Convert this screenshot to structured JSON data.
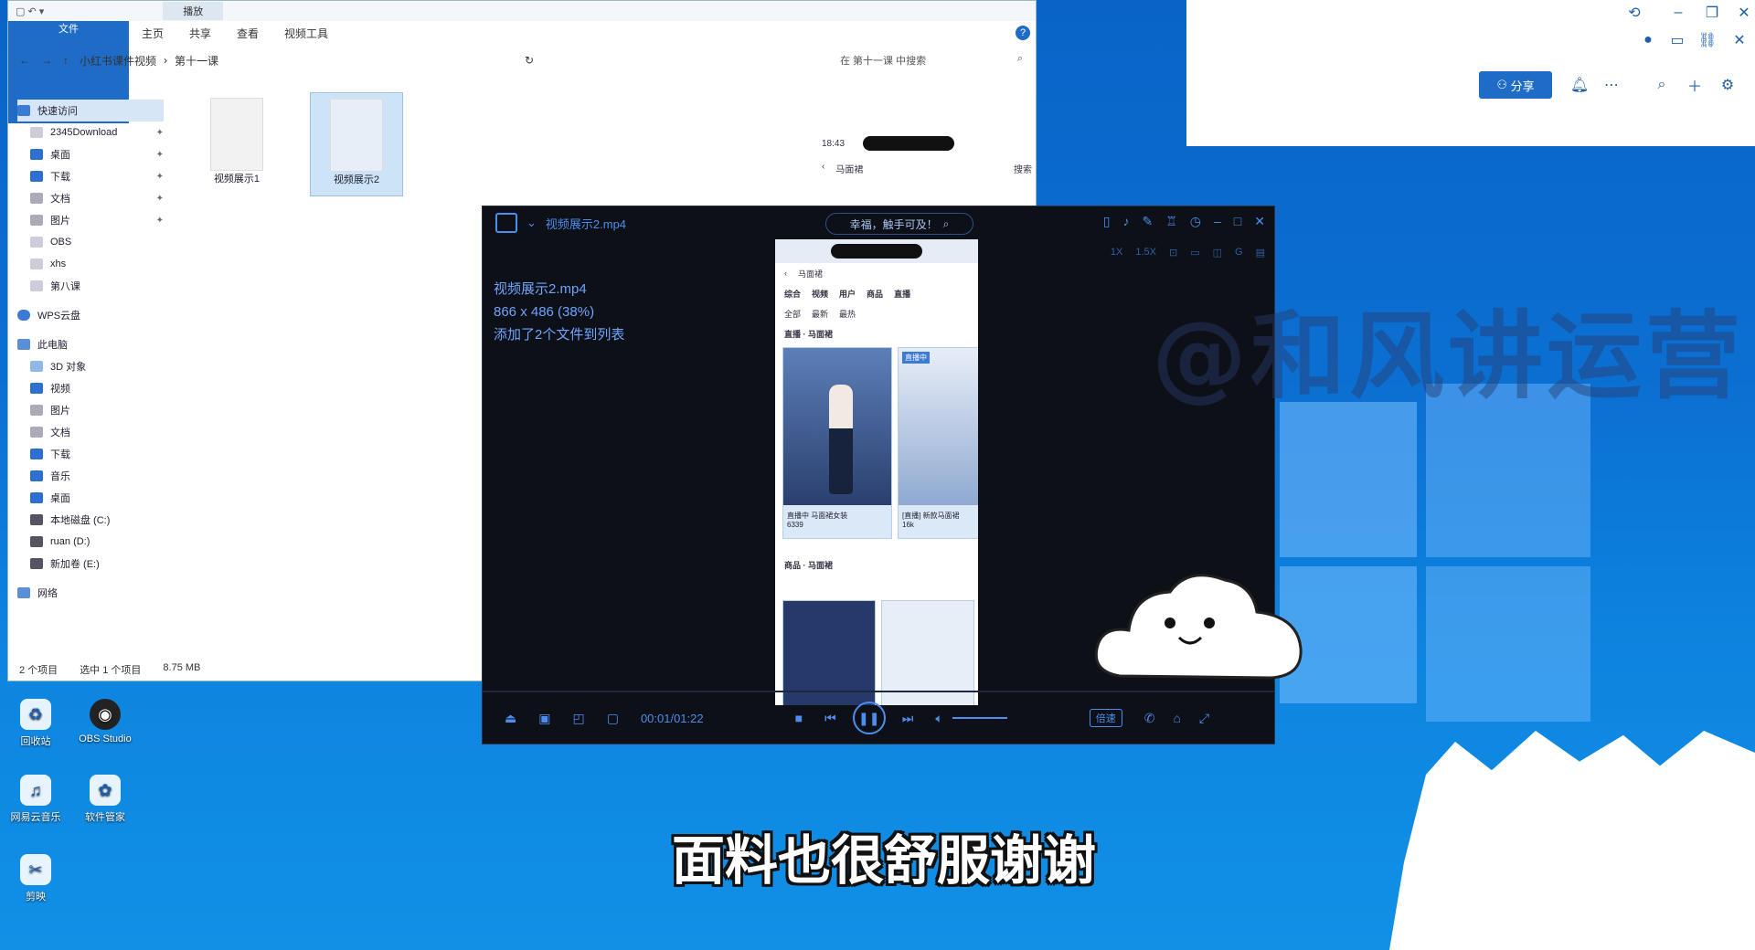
{
  "explorer": {
    "title_context_tab": "播放",
    "ribbon_tabs": [
      "文件",
      "主页",
      "共享",
      "查看",
      "视频工具"
    ],
    "breadcrumb": [
      "小红书课件视频",
      "第十一课"
    ],
    "search_placeholder": "在 第十一课 中搜索",
    "nav": {
      "quick_access": "快速访问",
      "quick_items": [
        "2345Download",
        "桌面",
        "下载",
        "文档",
        "图片",
        "OBS",
        "xhs",
        "第八课"
      ],
      "wps": "WPS云盘",
      "this_pc": "此电脑",
      "pc_items": [
        "3D 对象",
        "视频",
        "图片",
        "文档",
        "下载",
        "音乐",
        "桌面",
        "本地磁盘 (C:)",
        "ruan (D:)",
        "新加卷 (E:)"
      ],
      "network": "网络"
    },
    "files": [
      "视频展示1",
      "视频展示2"
    ],
    "status": {
      "count": "2 个项目",
      "selected": "选中 1 个项目",
      "size": "8.75 MB"
    },
    "preview_time": "18:43",
    "preview_search": "马面裙",
    "preview_btn": "搜索"
  },
  "right_panel": {
    "share_label": "分享"
  },
  "player": {
    "title": "视频展示2.mp4",
    "search_text": "幸福，触手可及！",
    "info_lines": [
      "视频展示2.mp4",
      "866 x 486 (38%)",
      "添加了2个文件到列表"
    ],
    "sub_toolbar": [
      "1X",
      "1.5X"
    ],
    "time": "00:01/01:22",
    "speed_label": "倍速",
    "video": {
      "search": "马面裙",
      "tabs": [
        "综合",
        "视频",
        "用户",
        "商品",
        "直播"
      ],
      "filters": [
        "全部",
        "最新",
        "最热"
      ],
      "section_live": "直播 · 马面裙",
      "section_goods": "商品 · 马面裙",
      "card1_caption": "直播中 马面裙女装",
      "card1_count": "6339",
      "card2_caption": "[直播] 新款马面裙",
      "card2_count": "16k",
      "badge": "直播中"
    }
  },
  "desktop": {
    "icons": [
      "回收站",
      "OBS Studio",
      "网易云音乐",
      "软件管家",
      "剪映"
    ]
  },
  "overlay": {
    "watermark": "@和风讲运营",
    "subtitle": "面料也很舒服谢谢"
  }
}
